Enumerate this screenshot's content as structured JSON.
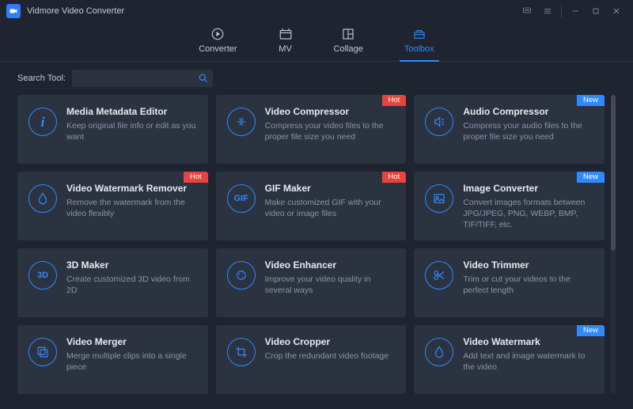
{
  "app": {
    "title": "Vidmore Video Converter"
  },
  "tabs": [
    {
      "id": "converter",
      "label": "Converter"
    },
    {
      "id": "mv",
      "label": "MV"
    },
    {
      "id": "collage",
      "label": "Collage"
    },
    {
      "id": "toolbox",
      "label": "Toolbox",
      "active": true
    }
  ],
  "search": {
    "label": "Search Tool:",
    "value": ""
  },
  "badges": {
    "hot": "Hot",
    "new": "New"
  },
  "tools": [
    {
      "icon": "info",
      "title": "Media Metadata Editor",
      "desc": "Keep original file info or edit as you want"
    },
    {
      "icon": "compress",
      "title": "Video Compressor",
      "desc": "Compress your video files to the proper file size you need",
      "badge": "hot"
    },
    {
      "icon": "audio",
      "title": "Audio Compressor",
      "desc": "Compress your audio files to the proper file size you need",
      "badge": "new"
    },
    {
      "icon": "drop",
      "title": "Video Watermark Remover",
      "desc": "Remove the watermark from the video flexibly",
      "badge": "hot"
    },
    {
      "icon": "gif",
      "title": "GIF Maker",
      "desc": "Make customized GIF with your video or image files",
      "badge": "hot"
    },
    {
      "icon": "image",
      "title": "Image Converter",
      "desc": "Convert images formats between JPG/JPEG, PNG, WEBP, BMP, TIF/TIFF, etc.",
      "badge": "new"
    },
    {
      "icon": "3d",
      "title": "3D Maker",
      "desc": "Create customized 3D video from 2D"
    },
    {
      "icon": "enhance",
      "title": "Video Enhancer",
      "desc": "Improve your video quality in several ways"
    },
    {
      "icon": "trim",
      "title": "Video Trimmer",
      "desc": "Trim or cut your videos to the perfect length"
    },
    {
      "icon": "merge",
      "title": "Video Merger",
      "desc": "Merge multiple clips into a single piece"
    },
    {
      "icon": "crop",
      "title": "Video Cropper",
      "desc": "Crop the redundant video footage"
    },
    {
      "icon": "drop",
      "title": "Video Watermark",
      "desc": "Add text and image watermark to the video",
      "badge": "new"
    }
  ]
}
